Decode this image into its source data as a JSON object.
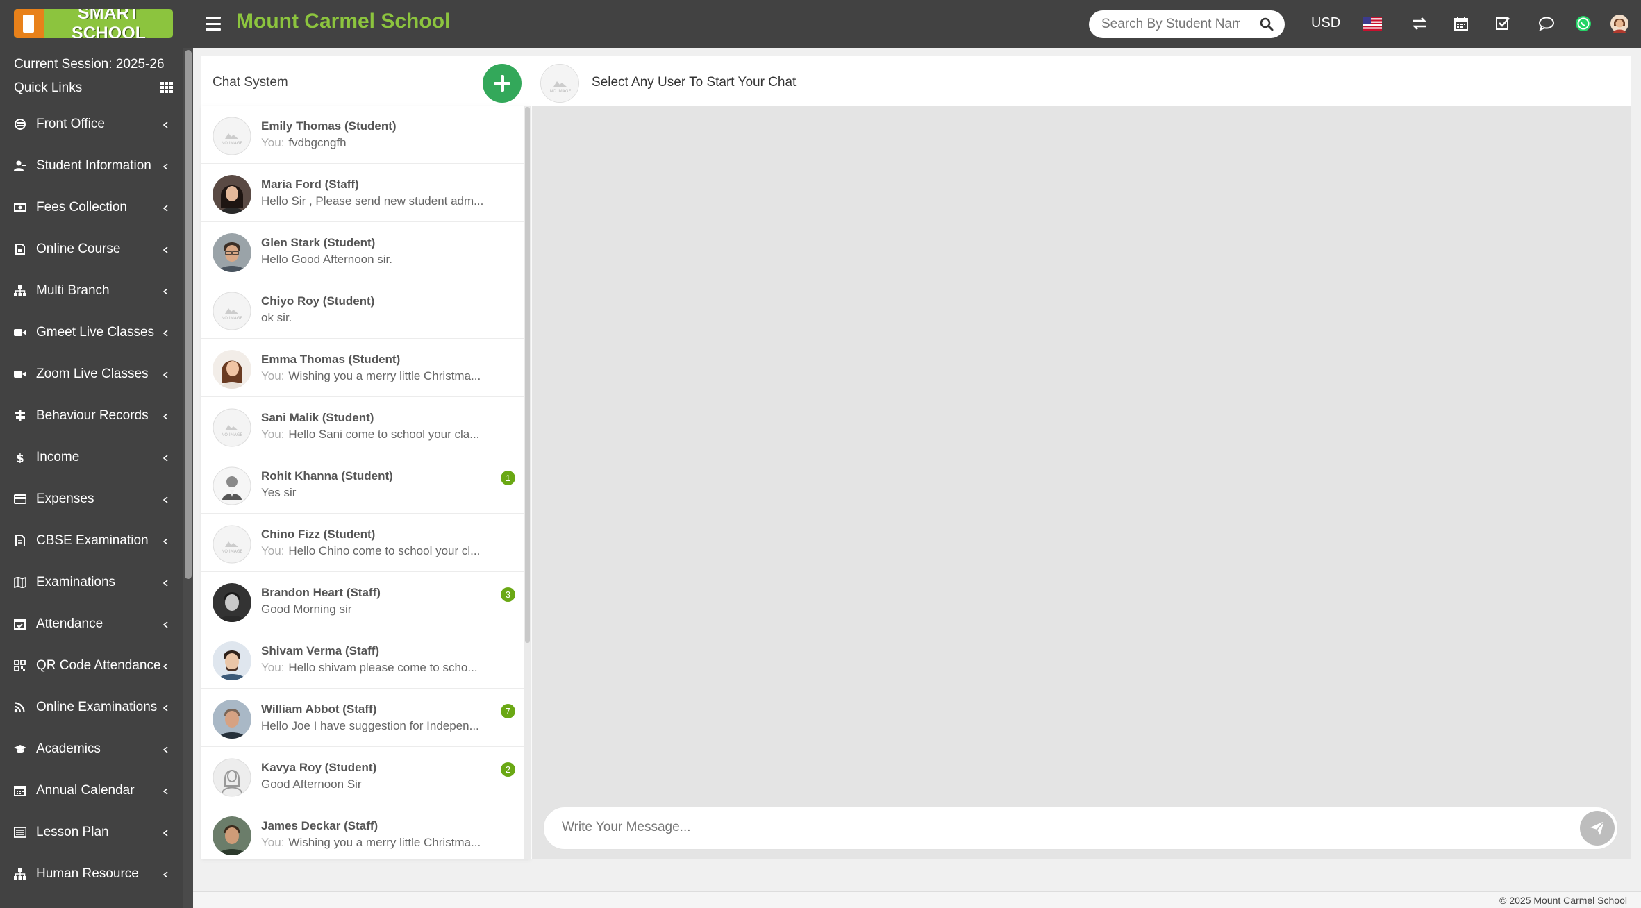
{
  "header": {
    "logo_text": "SMART SCHOOL",
    "school_name": "Mount Carmel School",
    "search_placeholder": "Search By Student Name",
    "currency": "USD"
  },
  "sidebar": {
    "session": "Current Session: 2025-26",
    "quick_links": "Quick Links",
    "items": [
      {
        "label": "Front Office",
        "icon": "front-office-icon"
      },
      {
        "label": "Student Information",
        "icon": "student-icon"
      },
      {
        "label": "Fees Collection",
        "icon": "money-icon"
      },
      {
        "label": "Online Course",
        "icon": "course-icon"
      },
      {
        "label": "Multi Branch",
        "icon": "sitemap-icon"
      },
      {
        "label": "Gmeet Live Classes",
        "icon": "video-icon"
      },
      {
        "label": "Zoom Live Classes",
        "icon": "video-icon"
      },
      {
        "label": "Behaviour Records",
        "icon": "signpost-icon"
      },
      {
        "label": "Income",
        "icon": "dollar-icon"
      },
      {
        "label": "Expenses",
        "icon": "card-icon"
      },
      {
        "label": "CBSE Examination",
        "icon": "document-icon"
      },
      {
        "label": "Examinations",
        "icon": "map-icon"
      },
      {
        "label": "Attendance",
        "icon": "calendar-check-icon"
      },
      {
        "label": "QR Code Attendance",
        "icon": "qrcode-icon"
      },
      {
        "label": "Online Examinations",
        "icon": "rss-icon"
      },
      {
        "label": "Academics",
        "icon": "graduation-icon"
      },
      {
        "label": "Annual Calendar",
        "icon": "calendar-icon"
      },
      {
        "label": "Lesson Plan",
        "icon": "list-icon"
      },
      {
        "label": "Human Resource",
        "icon": "sitemap-icon"
      }
    ]
  },
  "chat": {
    "title": "Chat System",
    "conversation_title": "Select Any User To Start Your Chat",
    "message_placeholder": "Write Your Message...",
    "you_label": "You:",
    "users": [
      {
        "name": "Emily Thomas (Student)",
        "message": "fvdbgcngfh",
        "you": true,
        "avatar": "no-image",
        "badge": ""
      },
      {
        "name": "Maria Ford (Staff)",
        "message": "Hello Sir , Please send new student adm...",
        "you": false,
        "avatar": "photo-woman-dark",
        "badge": ""
      },
      {
        "name": "Glen Stark (Student)",
        "message": "Hello Good Afternoon sir.",
        "you": false,
        "avatar": "photo-man-glasses",
        "badge": ""
      },
      {
        "name": "Chiyo Roy (Student)",
        "message": "ok sir.",
        "you": false,
        "avatar": "no-image",
        "badge": ""
      },
      {
        "name": "Emma Thomas (Student)",
        "message": "Wishing you a merry little Christma...",
        "you": true,
        "avatar": "photo-woman-smile",
        "badge": ""
      },
      {
        "name": "Sani Malik (Student)",
        "message": "Hello Sani come to school your cla...",
        "you": true,
        "avatar": "no-image",
        "badge": ""
      },
      {
        "name": "Rohit Khanna (Student)",
        "message": "Yes sir",
        "you": false,
        "avatar": "user-silhouette",
        "badge": "1"
      },
      {
        "name": "Chino Fizz (Student)",
        "message": "Hello Chino come to school your cl...",
        "you": true,
        "avatar": "no-image",
        "badge": ""
      },
      {
        "name": "Brandon Heart (Staff)",
        "message": "Good Morning sir",
        "you": false,
        "avatar": "photo-man-bw",
        "badge": "3"
      },
      {
        "name": "Shivam Verma (Staff)",
        "message": "Hello shivam please come to scho...",
        "you": true,
        "avatar": "photo-man-beard",
        "badge": ""
      },
      {
        "name": "William Abbot (Staff)",
        "message": "Hello Joe I have suggestion for Indepen...",
        "you": false,
        "avatar": "photo-man-older",
        "badge": "7"
      },
      {
        "name": "Kavya Roy (Student)",
        "message": "Good Afternoon Sir",
        "you": false,
        "avatar": "user-female-silhouette",
        "badge": "2"
      },
      {
        "name": "James Deckar (Staff)",
        "message": "Wishing you a merry little Christma...",
        "you": true,
        "avatar": "photo-man-smile",
        "badge": ""
      }
    ]
  },
  "footer": {
    "copyright": "© 2025 Mount Carmel School"
  },
  "colors": {
    "accent": "#8cc43e",
    "dark": "#424242",
    "add_button": "#33a85a",
    "badge": "#6aa814"
  }
}
